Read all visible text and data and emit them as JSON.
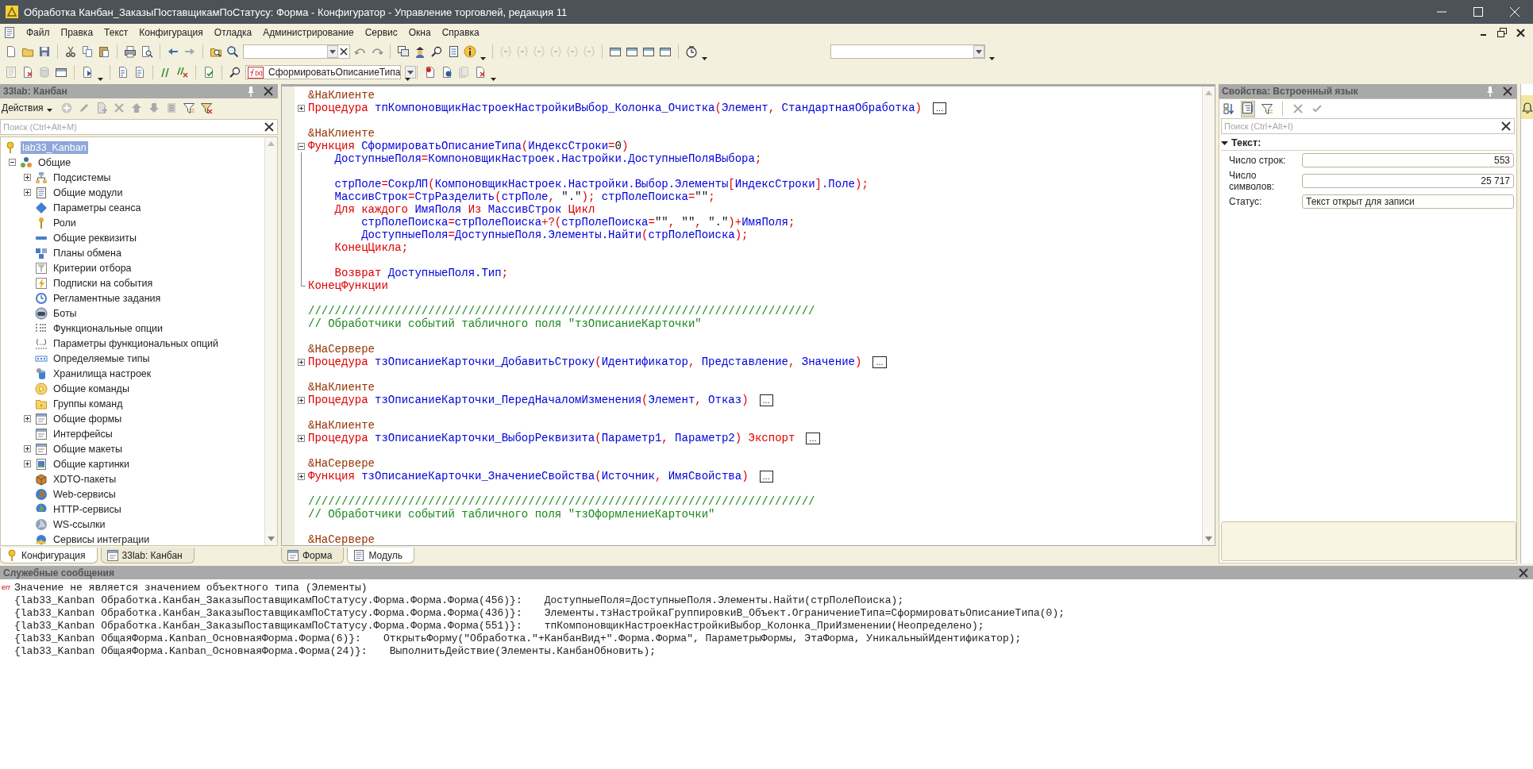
{
  "window": {
    "title": "Обработка Канбан_ЗаказыПоставщикамПоСтатусу: Форма - Конфигуратор - Управление торговлей, редакция 11"
  },
  "menu": [
    "Файл",
    "Правка",
    "Текст",
    "Конфигурация",
    "Отладка",
    "Администрирование",
    "Сервис",
    "Окна",
    "Справка"
  ],
  "toolbar": {
    "method_selector": "СформироватьОписаниеТипа"
  },
  "config_panel": {
    "title": "33lab: Канбан",
    "actions_label": "Действия",
    "search_placeholder": "Поиск (Ctrl+Alt+M)",
    "tree": [
      {
        "label": "lab33_Kanban",
        "selected": true,
        "children": [
          {
            "label": "Общие",
            "selected": false,
            "expanded": true,
            "children": [
              {
                "label": "Подсистемы",
                "selected": false,
                "expanded": false
              },
              {
                "label": "Общие модули",
                "selected": false,
                "expanded": false
              },
              {
                "label": "Параметры сеанса",
                "selected": false
              },
              {
                "label": "Роли",
                "selected": false
              },
              {
                "label": "Общие реквизиты",
                "selected": false
              },
              {
                "label": "Планы обмена",
                "selected": false
              },
              {
                "label": "Критерии отбора",
                "selected": false
              },
              {
                "label": "Подписки на события",
                "selected": false
              },
              {
                "label": "Регламентные задания",
                "selected": false
              },
              {
                "label": "Боты",
                "selected": false
              },
              {
                "label": "Функциональные опции",
                "selected": false
              },
              {
                "label": "Параметры функциональных опций",
                "selected": false
              },
              {
                "label": "Определяемые типы",
                "selected": false
              },
              {
                "label": "Хранилища настроек",
                "selected": false
              },
              {
                "label": "Общие команды",
                "selected": false
              },
              {
                "label": "Группы команд",
                "selected": false
              },
              {
                "label": "Общие формы",
                "selected": false,
                "expanded": false
              },
              {
                "label": "Интерфейсы",
                "selected": false
              },
              {
                "label": "Общие макеты",
                "selected": false,
                "expanded": false
              },
              {
                "label": "Общие картинки",
                "selected": false,
                "expanded": false
              },
              {
                "label": "XDTO-пакеты",
                "selected": false
              },
              {
                "label": "Web-сервисы",
                "selected": false
              },
              {
                "label": "HTTP-сервисы",
                "selected": false
              },
              {
                "label": "WS-ссылки",
                "selected": false
              },
              {
                "label": "Сервисы интеграции",
                "selected": false
              }
            ]
          }
        ]
      }
    ],
    "tabs": [
      {
        "label": "Конфигурация",
        "selected": true
      },
      {
        "label": "33lab: Канбан",
        "selected": false
      }
    ]
  },
  "editor": {
    "lines": [
      {
        "kind": "plain",
        "tokens": [
          {
            "kind": "directive",
            "text": "&НаКлиенте"
          }
        ]
      },
      {
        "kind": "collapsed",
        "collapsed_text": "...",
        "tokens": [
          {
            "kind": "keyword",
            "text": "Процедура"
          },
          {
            "kind": "ident",
            "text": " тпКомпоновщикНастроекНастройкиВыбор_Колонка_Очистка"
          },
          {
            "kind": "op",
            "text": "("
          },
          {
            "kind": "ident",
            "text": "Элемент"
          },
          {
            "kind": "op",
            "text": ","
          },
          {
            "kind": "ident",
            "text": " СтандартнаяОбработка"
          },
          {
            "kind": "op",
            "text": ")"
          }
        ]
      },
      {
        "kind": "plain"
      },
      {
        "kind": "plain",
        "tokens": [
          {
            "kind": "directive",
            "text": "&НаКлиенте"
          }
        ]
      },
      {
        "kind": "expanded",
        "tokens": [
          {
            "kind": "keyword",
            "text": "Функция"
          },
          {
            "kind": "ident",
            "text": " СформироватьОписаниеТипа"
          },
          {
            "kind": "op",
            "text": "("
          },
          {
            "kind": "ident",
            "text": "ИндексСтроки"
          },
          {
            "kind": "op",
            "text": "="
          },
          {
            "kind": "literal",
            "text": "0"
          },
          {
            "kind": "op",
            "text": ")"
          }
        ]
      },
      {
        "kind": "body",
        "tokens": [
          {
            "kind": "ident",
            "text": "    ДоступныеПоля"
          },
          {
            "kind": "op",
            "text": "="
          },
          {
            "kind": "ident",
            "text": "КомпоновщикНастроек.Настройки.ДоступныеПоляВыбора"
          },
          {
            "kind": "op",
            "text": ";"
          }
        ]
      },
      {
        "kind": "body"
      },
      {
        "kind": "body",
        "tokens": [
          {
            "kind": "ident",
            "text": "    стрПоле"
          },
          {
            "kind": "op",
            "text": "="
          },
          {
            "kind": "ident",
            "text": "СокрЛП"
          },
          {
            "kind": "op",
            "text": "("
          },
          {
            "kind": "ident",
            "text": "КомпоновщикНастроек.Настройки.Выбор.Элементы"
          },
          {
            "kind": "op",
            "text": "["
          },
          {
            "kind": "ident",
            "text": "ИндексСтроки"
          },
          {
            "kind": "op",
            "text": "]"
          },
          {
            "kind": "ident",
            "text": ".Поле"
          },
          {
            "kind": "op",
            "text": ");"
          }
        ]
      },
      {
        "kind": "body",
        "tokens": [
          {
            "kind": "ident",
            "text": "    МассивСтрок"
          },
          {
            "kind": "op",
            "text": "="
          },
          {
            "kind": "ident",
            "text": "СтрРазделить"
          },
          {
            "kind": "op",
            "text": "("
          },
          {
            "kind": "ident",
            "text": "стрПоле"
          },
          {
            "kind": "op",
            "text": ","
          },
          {
            "kind": "literal",
            "text": " \".\""
          },
          {
            "kind": "op",
            "text": ");"
          },
          {
            "kind": "ident",
            "text": " стрПолеПоиска"
          },
          {
            "kind": "op",
            "text": "="
          },
          {
            "kind": "literal",
            "text": "\"\""
          },
          {
            "kind": "op",
            "text": ";"
          }
        ]
      },
      {
        "kind": "body",
        "tokens": [
          {
            "kind": "keyword",
            "text": "    Для каждого"
          },
          {
            "kind": "ident",
            "text": " ИмяПоля"
          },
          {
            "kind": "keyword",
            "text": " Из"
          },
          {
            "kind": "ident",
            "text": " МассивСтрок"
          },
          {
            "kind": "keyword",
            "text": " Цикл"
          }
        ]
      },
      {
        "kind": "body",
        "tokens": [
          {
            "kind": "ident",
            "text": "        стрПолеПоиска"
          },
          {
            "kind": "op",
            "text": "="
          },
          {
            "kind": "ident",
            "text": "стрПолеПоиска"
          },
          {
            "kind": "op",
            "text": "+?("
          },
          {
            "kind": "ident",
            "text": "стрПолеПоиска"
          },
          {
            "kind": "op",
            "text": "="
          },
          {
            "kind": "literal",
            "text": "\"\""
          },
          {
            "kind": "op",
            "text": ","
          },
          {
            "kind": "literal",
            "text": " \"\""
          },
          {
            "kind": "op",
            "text": ","
          },
          {
            "kind": "literal",
            "text": " \".\""
          },
          {
            "kind": "op",
            "text": ")+"
          },
          {
            "kind": "ident",
            "text": "ИмяПоля"
          },
          {
            "kind": "op",
            "text": ";"
          }
        ]
      },
      {
        "kind": "body",
        "tokens": [
          {
            "kind": "ident",
            "text": "        ДоступныеПоля"
          },
          {
            "kind": "op",
            "text": "="
          },
          {
            "kind": "ident",
            "text": "ДоступныеПоля.Элементы.Найти"
          },
          {
            "kind": "op",
            "text": "("
          },
          {
            "kind": "ident",
            "text": "стрПолеПоиска"
          },
          {
            "kind": "op",
            "text": ");"
          }
        ]
      },
      {
        "kind": "body",
        "tokens": [
          {
            "kind": "keyword",
            "text": "    КонецЦикла"
          },
          {
            "kind": "op",
            "text": ";"
          }
        ]
      },
      {
        "kind": "body"
      },
      {
        "kind": "body",
        "tokens": [
          {
            "kind": "keyword",
            "text": "    Возврат"
          },
          {
            "kind": "ident",
            "text": " ДоступныеПоля.Тип"
          },
          {
            "kind": "op",
            "text": ";"
          }
        ]
      },
      {
        "kind": "end",
        "tokens": [
          {
            "kind": "keyword",
            "text": "КонецФункции"
          }
        ]
      },
      {
        "kind": "plain"
      },
      {
        "kind": "plain",
        "tokens": [
          {
            "kind": "comment",
            "text": "////////////////////////////////////////////////////////////////////////////"
          }
        ]
      },
      {
        "kind": "plain",
        "tokens": [
          {
            "kind": "comment",
            "text": "// Обработчики событий табличного поля \"тзОписаниеКарточки\""
          }
        ]
      },
      {
        "kind": "plain"
      },
      {
        "kind": "plain",
        "tokens": [
          {
            "kind": "directive",
            "text": "&НаСервере"
          }
        ]
      },
      {
        "kind": "collapsed",
        "collapsed_text": "...",
        "tokens": [
          {
            "kind": "keyword",
            "text": "Процедура"
          },
          {
            "kind": "ident",
            "text": " тзОписаниеКарточки_ДобавитьСтроку"
          },
          {
            "kind": "op",
            "text": "("
          },
          {
            "kind": "ident",
            "text": "Идентификатор"
          },
          {
            "kind": "op",
            "text": ","
          },
          {
            "kind": "ident",
            "text": " Представление"
          },
          {
            "kind": "op",
            "text": ","
          },
          {
            "kind": "ident",
            "text": " Значение"
          },
          {
            "kind": "op",
            "text": ")"
          }
        ]
      },
      {
        "kind": "plain"
      },
      {
        "kind": "plain",
        "tokens": [
          {
            "kind": "directive",
            "text": "&НаКлиенте"
          }
        ]
      },
      {
        "kind": "collapsed",
        "collapsed_text": "...",
        "tokens": [
          {
            "kind": "keyword",
            "text": "Процедура"
          },
          {
            "kind": "ident",
            "text": " тзОписаниеКарточки_ПередНачаломИзменения"
          },
          {
            "kind": "op",
            "text": "("
          },
          {
            "kind": "ident",
            "text": "Элемент"
          },
          {
            "kind": "op",
            "text": ","
          },
          {
            "kind": "ident",
            "text": " Отказ"
          },
          {
            "kind": "op",
            "text": ")"
          }
        ]
      },
      {
        "kind": "plain"
      },
      {
        "kind": "plain",
        "tokens": [
          {
            "kind": "directive",
            "text": "&НаКлиенте"
          }
        ]
      },
      {
        "kind": "collapsed",
        "collapsed_text": "...",
        "tokens": [
          {
            "kind": "keyword",
            "text": "Процедура"
          },
          {
            "kind": "ident",
            "text": " тзОписаниеКарточки_ВыборРеквизита"
          },
          {
            "kind": "op",
            "text": "("
          },
          {
            "kind": "ident",
            "text": "Параметр1"
          },
          {
            "kind": "op",
            "text": ","
          },
          {
            "kind": "ident",
            "text": " Параметр2"
          },
          {
            "kind": "op",
            "text": ")"
          },
          {
            "kind": "keyword",
            "text": " Экспорт"
          }
        ]
      },
      {
        "kind": "plain"
      },
      {
        "kind": "plain",
        "tokens": [
          {
            "kind": "directive",
            "text": "&НаСервере"
          }
        ]
      },
      {
        "kind": "collapsed",
        "collapsed_text": "...",
        "tokens": [
          {
            "kind": "keyword",
            "text": "Функция"
          },
          {
            "kind": "ident",
            "text": " тзОписаниеКарточки_ЗначениеСвойства"
          },
          {
            "kind": "op",
            "text": "("
          },
          {
            "kind": "ident",
            "text": "Источник"
          },
          {
            "kind": "op",
            "text": ","
          },
          {
            "kind": "ident",
            "text": " ИмяСвойства"
          },
          {
            "kind": "op",
            "text": ")"
          }
        ]
      },
      {
        "kind": "plain"
      },
      {
        "kind": "plain",
        "tokens": [
          {
            "kind": "comment",
            "text": "////////////////////////////////////////////////////////////////////////////"
          }
        ]
      },
      {
        "kind": "plain",
        "tokens": [
          {
            "kind": "comment",
            "text": "// Обработчики событий табличного поля \"тзОформлениеКарточки\""
          }
        ]
      },
      {
        "kind": "plain"
      },
      {
        "kind": "plain",
        "tokens": [
          {
            "kind": "directive",
            "text": "&НаСервере"
          }
        ]
      }
    ],
    "tabs": [
      {
        "label": "Форма",
        "selected": false
      },
      {
        "label": "Модуль",
        "selected": true
      }
    ]
  },
  "properties": {
    "title": "Свойства: Встроенный язык",
    "search_placeholder": "Поиск (Ctrl+Alt+I)",
    "group": {
      "label": "Текст:",
      "expanded": true
    },
    "fields": [
      {
        "label": "Число строк:",
        "value": "553",
        "kind": "number"
      },
      {
        "label": "Число символов:",
        "value": "25 717",
        "kind": "number"
      },
      {
        "label": "Статус:",
        "value": "Текст открыт для записи",
        "kind": "text"
      }
    ]
  },
  "messages": {
    "title": "Служебные сообщения",
    "items": [
      {
        "kind": "error",
        "badge": "err",
        "text": "Значение не является значением объектного типа (Элементы)"
      },
      {
        "kind": "trace",
        "location": "{lab33_Kanban Обработка.Канбан_ЗаказыПоставщикамПоСтатусу.Форма.Форма.Форма(456)}:",
        "code": "ДоступныеПоля=ДоступныеПоля.Элементы.Найти(стрПолеПоиска);"
      },
      {
        "kind": "trace",
        "location": "{lab33_Kanban Обработка.Канбан_ЗаказыПоставщикамПоСтатусу.Форма.Форма.Форма(436)}:",
        "code": "Элементы.тзНастройкаГруппировкиВ_Объект.ОграничениеТипа=СформироватьОписаниеТипа(0);"
      },
      {
        "kind": "trace",
        "location": "{lab33_Kanban Обработка.Канбан_ЗаказыПоставщикамПоСтатусу.Форма.Форма.Форма(551)}:",
        "code": "тпКомпоновщикНастроекНастройкиВыбор_Колонка_ПриИзменении(Неопределено);"
      },
      {
        "kind": "trace",
        "location": "{lab33_Kanban ОбщаяФорма.Kanban_ОсновнаяФорма.Форма(6)}:",
        "code": "ОткрытьФорму(\"Обработка.\"+КанбанВид+\".Форма.Форма\", ПараметрыФормы, ЭтаФорма, УникальныйИдентификатор);"
      },
      {
        "kind": "trace",
        "location": "{lab33_Kanban ОбщаяФорма.Kanban_ОсновнаяФорма.Форма(24)}:",
        "code": "ВыполнитьДействие(Элементы.КанбанОбновить);"
      }
    ]
  }
}
